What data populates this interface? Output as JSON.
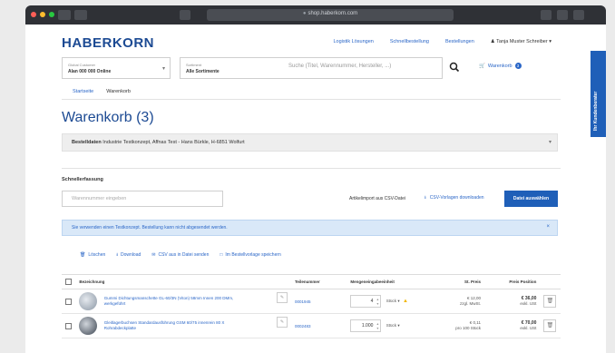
{
  "browser": {
    "url": "shop.haberkorn.com",
    "colors": {
      "close": "#ff5f57",
      "min": "#febc2e",
      "max": "#28c840"
    }
  },
  "header": {
    "logo": "HABERKORN",
    "links": [
      "Logistik Lösungen",
      "Schnellbestellung",
      "Bestellungen"
    ],
    "user_label": "Tanja Muster Schreiber"
  },
  "search": {
    "customer_label": "Global Customer",
    "customer_value": "Alan 000 000 Online",
    "category_label": "Sortiment",
    "category_value": "Alle Sortimente",
    "placeholder": "Suche (Titel, Warennummer, Hersteller, ...)",
    "cart_label": "Warenkorb",
    "cart_count": "3"
  },
  "breadcrumb": {
    "home": "Startseite",
    "current": "Warenkorb"
  },
  "page": {
    "title": "Warenkorb (3)"
  },
  "order_info": {
    "label": "Bestelldaten",
    "value": "Industrie Testkonzept, Affnas Test - Hans Bürkle, H-6851 Wolfurt"
  },
  "quick_order": {
    "label": "Schnellerfassung",
    "placeholder": "Warennummer eingeben",
    "import_label": "Artikelimport aus CSV-Datei",
    "upload_label": "CSV-Vorlagen downloaden",
    "button": "Datei auswählen"
  },
  "info_bar": {
    "text": "Sie verwenden einen Testkonzept. Bestellung kann nicht abgesendet werden."
  },
  "actions": [
    "Löschen",
    "Download",
    "CSV aus in Datei senden",
    "Im Bestellvorlage speichern"
  ],
  "table": {
    "headers": [
      "Bezeichnung",
      "Teilenummer",
      "Mengeneingabeeinheit",
      "St. Preis",
      "Preis Position"
    ],
    "rows": [
      {
        "description": "Gummi Dichtungsmanschette GL-60/3N (Viton) 58mm Innen 200 DMm, werkgeführt",
        "article": "0001945",
        "qty": "4",
        "unit": "Stück",
        "unit_price": "€ 12,00",
        "unit_price_note": "zzgl. MwSt.",
        "total": "€ 36,00",
        "total_note": "exkl. USt"
      },
      {
        "description": "Gleitlagerbuchsen Standardausführung GSM 60/75 innenrein 80 X Rohrabdeckplatte",
        "article": "0002483",
        "qty": "1.000",
        "unit": "Stück",
        "unit_price": "€ 0,11",
        "unit_price_note": "pro 100 Stück",
        "total": "€ 70,00",
        "total_note": "exkl. USt"
      }
    ]
  },
  "side_tab": {
    "label": "Ihr Kundenberater"
  },
  "colors": {
    "brand": "#1c4a93",
    "accent": "#1f5fb8",
    "link": "#2a66c7",
    "warning": "#f2b705"
  }
}
